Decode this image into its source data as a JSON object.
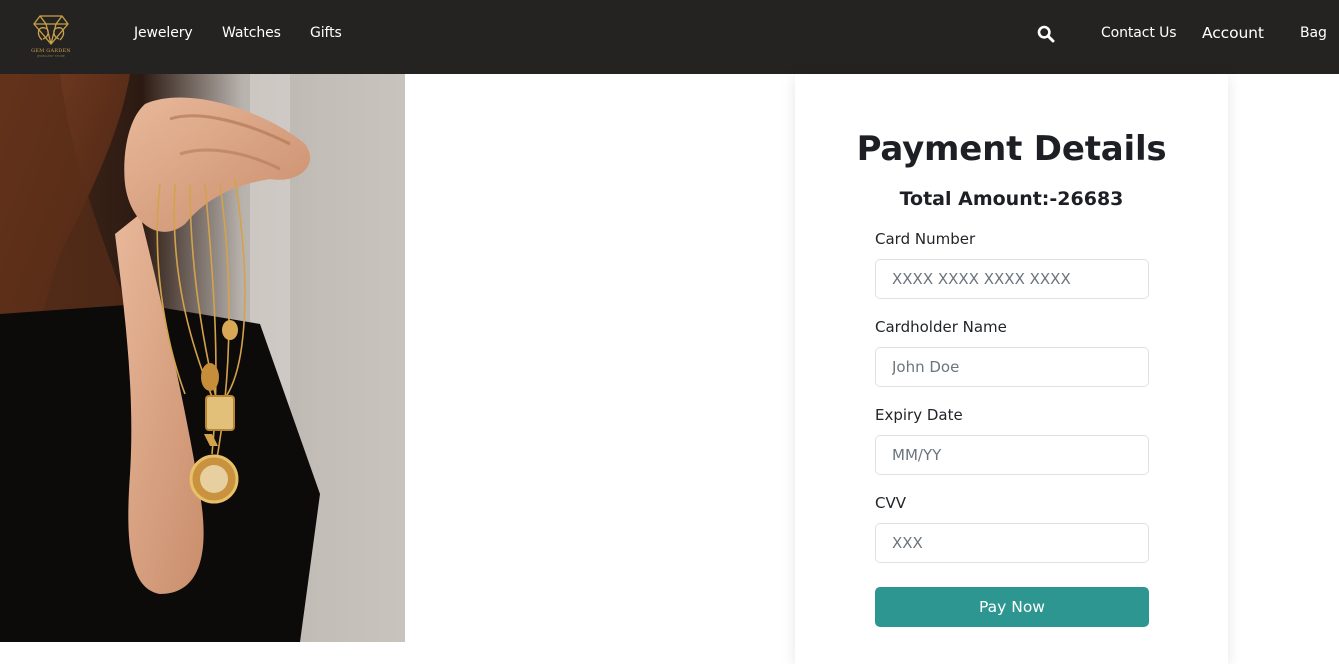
{
  "brand": {
    "logo_text": "GEM GARDEN",
    "logo_subtext": "JEWELLERY STORE"
  },
  "nav": {
    "links": [
      "Jewelery",
      "Watches",
      "Gifts"
    ],
    "right_links": [
      "Contact Us",
      "Account",
      "Bag"
    ],
    "search_icon": "search-icon"
  },
  "hero": {
    "image": "jewelry-hand-photo"
  },
  "payment": {
    "title": "Payment Details",
    "total_amount": "Total Amount:-26683",
    "fields": [
      {
        "label": "Card Number",
        "placeholder": "XXXX XXXX XXXX XXXX",
        "value": ""
      },
      {
        "label": "Cardholder Name",
        "placeholder": "John Doe",
        "value": ""
      },
      {
        "label": "Expiry Date",
        "placeholder": "MM/YY",
        "value": ""
      },
      {
        "label": "CVV",
        "placeholder": "XXX",
        "value": ""
      }
    ],
    "submit_label": "Pay Now"
  },
  "colors": {
    "navbar_bg": "#242322",
    "accent": "#2e9690",
    "logo_gold": "#c9a14a",
    "text_dark": "#1d1f24"
  }
}
